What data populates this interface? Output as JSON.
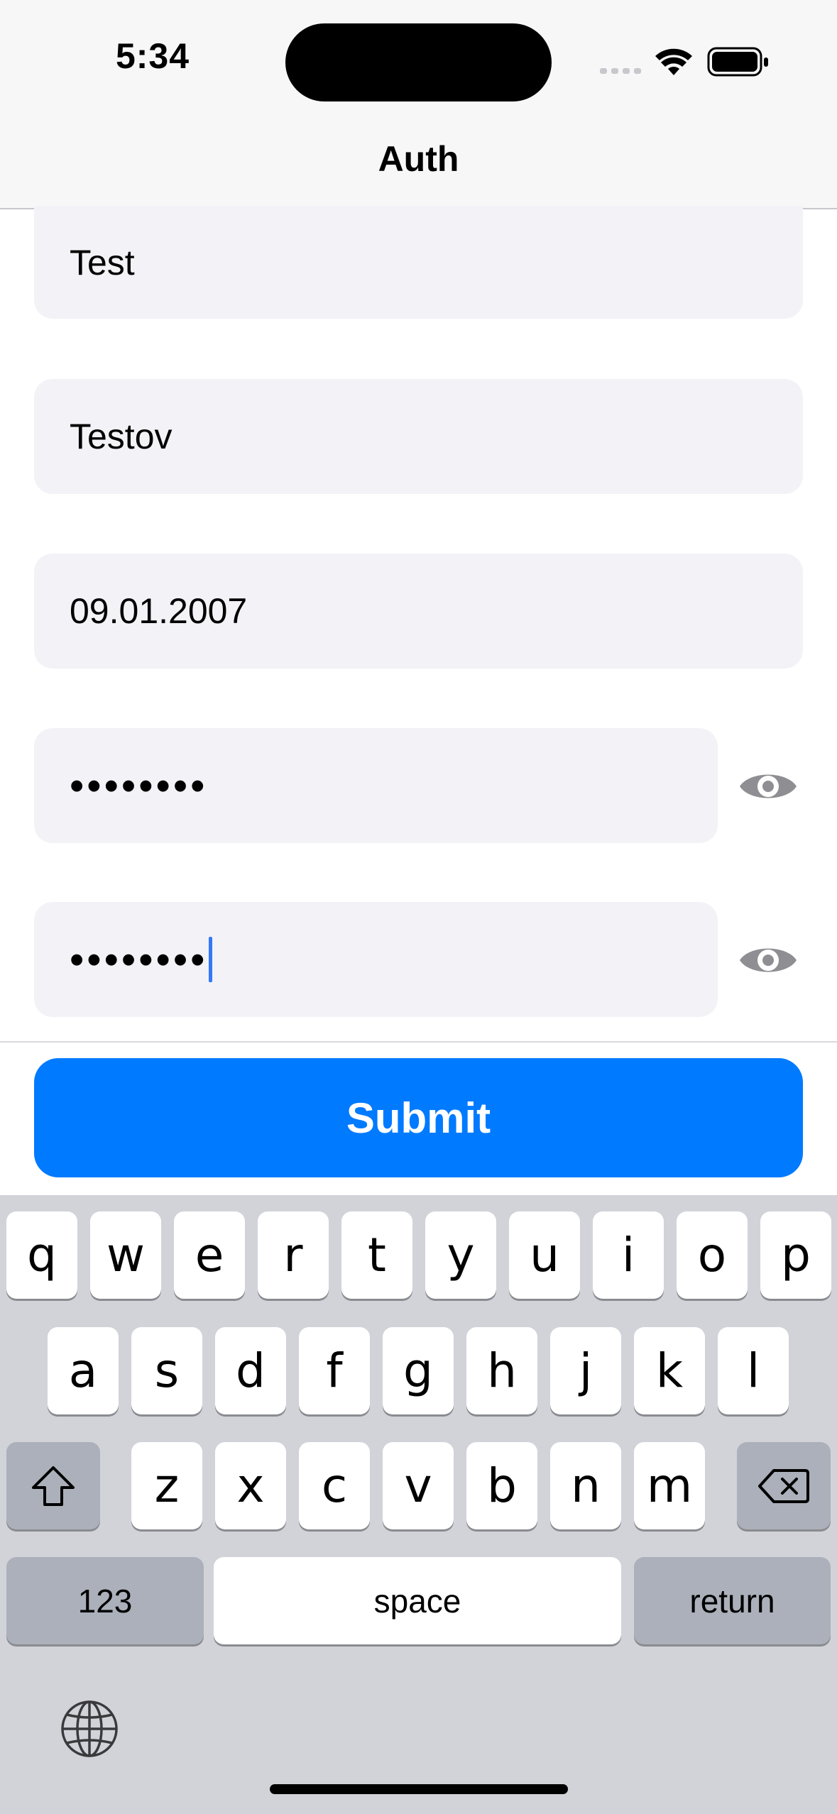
{
  "status_bar": {
    "time": "5:34"
  },
  "nav": {
    "title": "Auth"
  },
  "form": {
    "first_name": "Test",
    "last_name": "Testov",
    "birth_date": "09.01.2007",
    "password_masked": "••••••••",
    "confirm_password_masked": "••••••••",
    "submit_label": "Submit"
  },
  "colors": {
    "accent": "#007aff",
    "field_bg": "#f2f2f7",
    "keyboard_bg": "#d1d3d9"
  },
  "keyboard": {
    "row1": [
      "q",
      "w",
      "e",
      "r",
      "t",
      "y",
      "u",
      "i",
      "o",
      "p"
    ],
    "row2": [
      "a",
      "s",
      "d",
      "f",
      "g",
      "h",
      "j",
      "k",
      "l"
    ],
    "row3": [
      "z",
      "x",
      "c",
      "v",
      "b",
      "n",
      "m"
    ],
    "numbers_label": "123",
    "space_label": "space",
    "return_label": "return",
    "icons": [
      "shift-icon",
      "backspace-icon",
      "globe-icon"
    ]
  }
}
